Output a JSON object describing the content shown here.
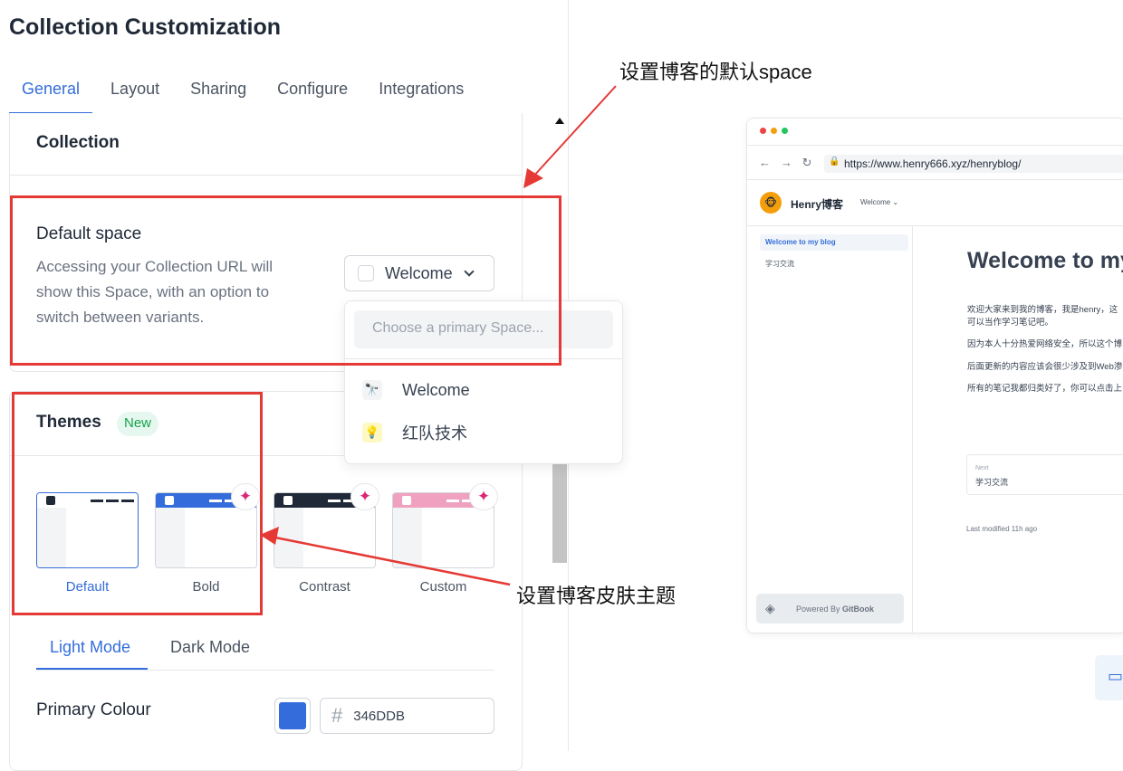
{
  "page_title": "Collection Customization",
  "tabs": [
    {
      "label": "General",
      "active": true
    },
    {
      "label": "Layout"
    },
    {
      "label": "Sharing"
    },
    {
      "label": "Configure"
    },
    {
      "label": "Integrations"
    }
  ],
  "collection": {
    "heading": "Collection",
    "default_space": {
      "title": "Default space",
      "description": "Accessing your Collection URL will show this Space, with an option to switch between variants.",
      "selected": "Welcome",
      "dropdown": {
        "placeholder": "Choose a primary Space...",
        "options": [
          {
            "label": "Welcome",
            "icon": "telescope-icon",
            "emoji": "🔭"
          },
          {
            "label": "红队技术",
            "icon": "lightbulb-icon",
            "emoji": "💡"
          }
        ]
      }
    }
  },
  "themes": {
    "title": "Themes",
    "badge": "New",
    "options": [
      {
        "label": "Default",
        "bar_color": "#ffffff",
        "square_color": "#1f2937",
        "selected": true
      },
      {
        "label": "Bold",
        "bar_color": "#346ddb",
        "square_color": "#ffffff",
        "premium": true
      },
      {
        "label": "Contrast",
        "bar_color": "#1f2937",
        "square_color": "#ffffff",
        "premium": true
      },
      {
        "label": "Custom",
        "bar_color": "#f0a1bf",
        "square_color": "#ffffff",
        "premium": true
      }
    ],
    "mode_tabs": [
      {
        "label": "Light Mode",
        "active": true
      },
      {
        "label": "Dark Mode"
      }
    ],
    "primary_colour": {
      "label": "Primary Colour",
      "value": "346DDB",
      "color": "#346ddb"
    }
  },
  "annotations": {
    "default_space": "设置博客的默认space",
    "theme": "设置博客皮肤主题"
  },
  "preview": {
    "url": "https://www.henry666.xyz/henryblog/",
    "site_name": "Henry博客",
    "space_selector": "Welcome",
    "sidebar_items": [
      "Welcome to my blog",
      "学习交流"
    ],
    "heading": "Welcome to my",
    "paragraphs": [
      "欢迎大家来到我的博客，我是henry，这",
      "可以当作学习笔记吧。",
      "因为本人十分热爱网络安全，所以这个博",
      "后面更新的内容应该会很少涉及到Web渗",
      "所有的笔记我都归类好了，你可以点击上"
    ],
    "next_label": "Next",
    "next_title": "学习交流",
    "last_modified": "Last modified 11h ago",
    "powered_by": "Powered By",
    "powered_brand": "GitBook"
  }
}
